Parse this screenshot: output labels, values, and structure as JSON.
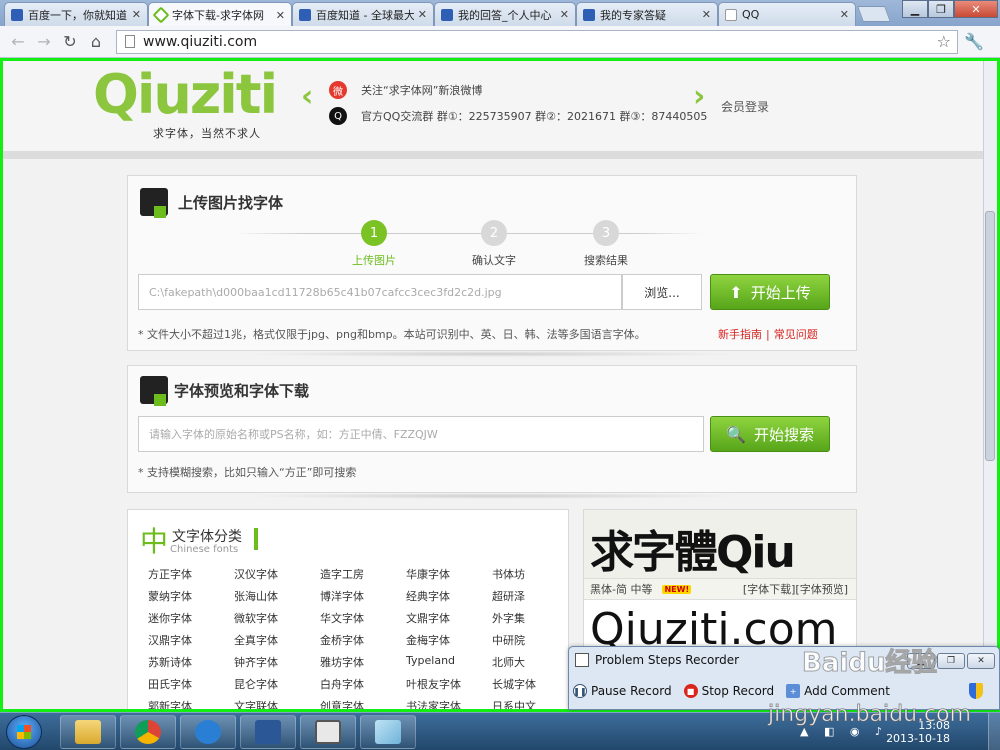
{
  "browser": {
    "tabs": [
      {
        "label": "百度一下，你就知道",
        "icon": "baidu-paw-icon"
      },
      {
        "label": "字体下载-求字体网",
        "icon": "qiuziti-pin-icon"
      },
      {
        "label": "百度知道 - 全球最大",
        "icon": "baidu-paw-icon"
      },
      {
        "label": "我的回答_个人中心",
        "icon": "baidu-paw-icon"
      },
      {
        "label": "我的专家答疑",
        "icon": "baidu-paw-icon"
      },
      {
        "label": "QQ",
        "icon": "document-icon"
      }
    ],
    "active_tab": 1,
    "url": "www.qiuziti.com"
  },
  "site": {
    "logo": "Qiuziti",
    "slogan": "求字体，当然不求人",
    "weibo_text": "关注“求字体网”新浪微博",
    "qq_text": "官方QQ交流群  群①：225735907   群②：2021671   群③：87440505",
    "login": "会员登录"
  },
  "upload": {
    "title": "上传图片找字体",
    "steps": [
      {
        "num": "1",
        "label": "上传图片"
      },
      {
        "num": "2",
        "label": "确认文字"
      },
      {
        "num": "3",
        "label": "搜索结果"
      }
    ],
    "active_step": 0,
    "file_path": "C:\\fakepath\\d000baa1cd11728b65c41b07cafcc3cec3fd2c2d.jpg",
    "browse": "浏览...",
    "upload_btn": "开始上传",
    "note": "* 文件大小不超过1兆，格式仅限于jpg、png和bmp。本站可识别中、英、日、韩、法等多国语言字体。",
    "guide_link": "新手指南",
    "faq_link": "常见问题"
  },
  "search": {
    "title": "字体预览和字体下载",
    "placeholder": "请输入字体的原始名称或PS名称，如：方正中倩、FZZQJW",
    "button": "开始搜索",
    "note": "* 支持模糊搜索，比如只输入“方正”即可搜索"
  },
  "categories": {
    "big_char": "中",
    "title": "文字体分类",
    "subtitle": "Chinese fonts",
    "items": [
      "方正字体",
      "汉仪字体",
      "造字工房",
      "华康字体",
      "书体坊",
      "蒙纳字体",
      "张海山体",
      "博洋字体",
      "经典字体",
      "超研泽",
      "迷你字体",
      "微软字体",
      "华文字体",
      "文鼎字体",
      "外字集",
      "汉鼎字体",
      "全真字体",
      "金桥字体",
      "金梅字体",
      "中研院",
      "苏新诗体",
      "钟齐字体",
      "雅坊字体",
      "Typeland",
      "北师大",
      "田氏字体",
      "昆仑字体",
      "白舟字体",
      "叶根友字体",
      "长城字体",
      "郭新字体",
      "文字联体",
      "创意字体",
      "书法家字体",
      "日系中文"
    ]
  },
  "preview": {
    "sample1": "求字體Qiu",
    "font_name": "黑体-简 中等",
    "new_badge": "NEW!",
    "links": "[字体下载][字体预览]",
    "sample2": "Qiuziti.com"
  },
  "psr": {
    "title": "Problem Steps Recorder",
    "pause": "Pause Record",
    "stop": "Stop Record",
    "add_comment": "Add Comment"
  },
  "taskbar": {
    "time": "13:08",
    "date": "2013-10-18"
  },
  "watermark": {
    "brand": "Baidu经验",
    "url": "jingyan.baidu.com"
  }
}
